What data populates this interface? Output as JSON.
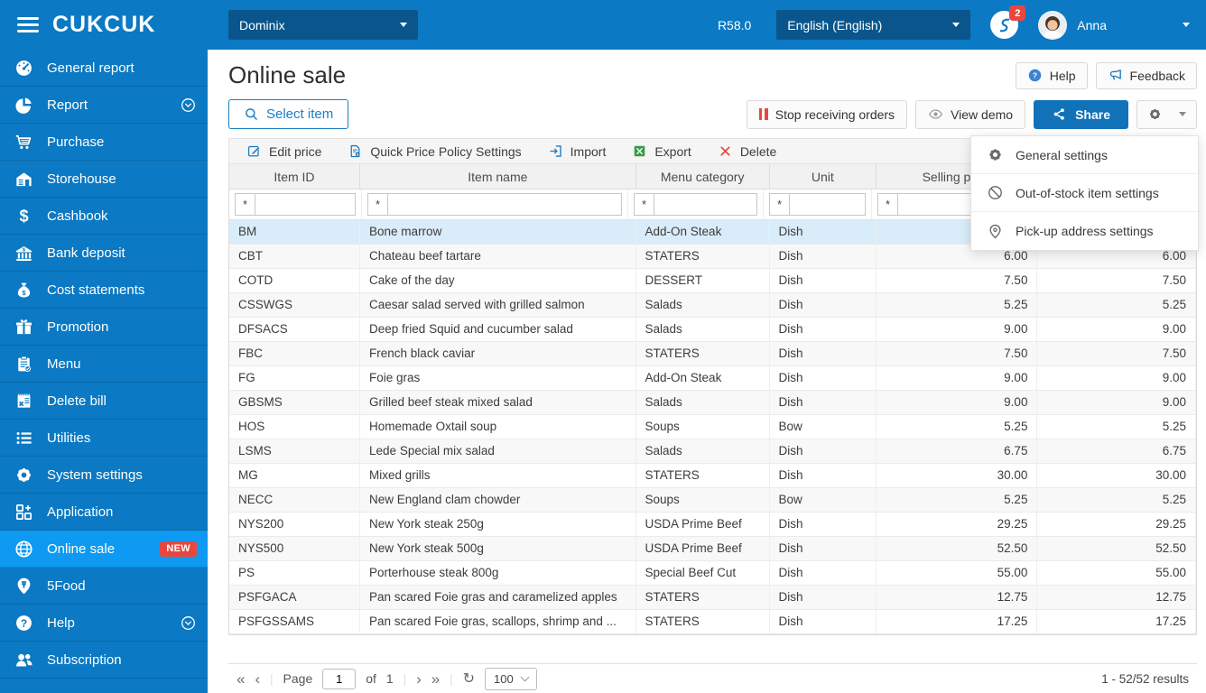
{
  "topbar": {
    "logo": "CUKCUK",
    "restaurant": "Dominix",
    "version": "R58.0",
    "language": "English (English)",
    "notification_count": "2",
    "user_name": "Anna"
  },
  "sidebar": {
    "items": [
      {
        "label": "General report",
        "icon": "gauge"
      },
      {
        "label": "Report",
        "icon": "pie",
        "expandable": true
      },
      {
        "label": "Purchase",
        "icon": "cart"
      },
      {
        "label": "Storehouse",
        "icon": "storehouse"
      },
      {
        "label": "Cashbook",
        "icon": "dollar"
      },
      {
        "label": "Bank deposit",
        "icon": "bank"
      },
      {
        "label": "Cost statements",
        "icon": "moneybag"
      },
      {
        "label": "Promotion",
        "icon": "gift"
      },
      {
        "label": "Menu",
        "icon": "clipboard"
      },
      {
        "label": "Delete bill",
        "icon": "bill-x"
      },
      {
        "label": "Utilities",
        "icon": "list"
      },
      {
        "label": "System settings",
        "icon": "gear-white"
      },
      {
        "label": "Application",
        "icon": "apps"
      },
      {
        "label": "Online sale",
        "icon": "globe",
        "active": true,
        "badge": "NEW"
      },
      {
        "label": "5Food",
        "icon": "pin-fork"
      },
      {
        "label": "Help",
        "icon": "question",
        "expandable": true
      },
      {
        "label": "Subscription",
        "icon": "users"
      }
    ]
  },
  "page": {
    "title": "Online sale",
    "help": "Help",
    "feedback": "Feedback",
    "select_item": "Select item",
    "stop_receiving_orders": "Stop receiving orders",
    "view_demo": "View demo",
    "share": "Share"
  },
  "toolbar": {
    "items": [
      {
        "label": "Edit price",
        "icon": "edit"
      },
      {
        "label": "Quick Price Policy Settings",
        "icon": "doc-badge"
      },
      {
        "label": "Import",
        "icon": "import"
      },
      {
        "label": "Export",
        "icon": "excel"
      },
      {
        "label": "Delete",
        "icon": "x-red"
      }
    ]
  },
  "settings_menu": {
    "items": [
      {
        "label": "General settings",
        "icon": "gear-gray"
      },
      {
        "label": "Out-of-stock item settings",
        "icon": "slash-circle"
      },
      {
        "label": "Pick-up address settings",
        "icon": "pin-outline"
      }
    ]
  },
  "table": {
    "columns": [
      "Item ID",
      "Item name",
      "Menu category",
      "Unit",
      "Selling price",
      ""
    ],
    "filter_operator": "*",
    "rows": [
      {
        "id": "BM",
        "name": "Bone marrow",
        "category": "Add-On Steak",
        "unit": "Dish",
        "price": "",
        "price2": "",
        "selected": true
      },
      {
        "id": "CBT",
        "name": "Chateau beef tartare",
        "category": "STATERS",
        "unit": "Dish",
        "price": "6.00",
        "price2": "6.00"
      },
      {
        "id": "COTD",
        "name": "Cake of the day",
        "category": "DESSERT",
        "unit": "Dish",
        "price": "7.50",
        "price2": "7.50"
      },
      {
        "id": "CSSWGS",
        "name": "Caesar salad served with grilled salmon",
        "category": "Salads",
        "unit": "Dish",
        "price": "5.25",
        "price2": "5.25"
      },
      {
        "id": "DFSACS",
        "name": "Deep fried Squid and cucumber salad",
        "category": "Salads",
        "unit": "Dish",
        "price": "9.00",
        "price2": "9.00"
      },
      {
        "id": "FBC",
        "name": "French black caviar",
        "category": "STATERS",
        "unit": "Dish",
        "price": "7.50",
        "price2": "7.50"
      },
      {
        "id": "FG",
        "name": "Foie gras",
        "category": "Add-On Steak",
        "unit": "Dish",
        "price": "9.00",
        "price2": "9.00"
      },
      {
        "id": "GBSMS",
        "name": "Grilled beef steak mixed salad",
        "category": "Salads",
        "unit": "Dish",
        "price": "9.00",
        "price2": "9.00"
      },
      {
        "id": "HOS",
        "name": "Homemade Oxtail soup",
        "category": "Soups",
        "unit": "Bow",
        "price": "5.25",
        "price2": "5.25"
      },
      {
        "id": "LSMS",
        "name": "Lede Special mix salad",
        "category": "Salads",
        "unit": "Dish",
        "price": "6.75",
        "price2": "6.75"
      },
      {
        "id": "MG",
        "name": "Mixed grills",
        "category": "STATERS",
        "unit": "Dish",
        "price": "30.00",
        "price2": "30.00"
      },
      {
        "id": "NECC",
        "name": "New England clam chowder",
        "category": "Soups",
        "unit": "Bow",
        "price": "5.25",
        "price2": "5.25"
      },
      {
        "id": "NYS200",
        "name": "New York steak 250g",
        "category": "USDA Prime Beef",
        "unit": "Dish",
        "price": "29.25",
        "price2": "29.25"
      },
      {
        "id": "NYS500",
        "name": "New York steak 500g",
        "category": "USDA Prime Beef",
        "unit": "Dish",
        "price": "52.50",
        "price2": "52.50"
      },
      {
        "id": "PS",
        "name": "Porterhouse steak 800g",
        "category": "Special Beef Cut",
        "unit": "Dish",
        "price": "55.00",
        "price2": "55.00"
      },
      {
        "id": "PSFGACA",
        "name": "Pan scared Foie gras and caramelized apples",
        "category": "STATERS",
        "unit": "Dish",
        "price": "12.75",
        "price2": "12.75"
      },
      {
        "id": "PSFGSSAMS",
        "name": "Pan scared Foie gras, scallops, shrimp and ...",
        "category": "STATERS",
        "unit": "Dish",
        "price": "17.25",
        "price2": "17.25"
      }
    ]
  },
  "pagination": {
    "page_label": "Page",
    "page_value": "1",
    "of_label": "of",
    "total_pages": "1",
    "page_size": "100",
    "results": "1 - 52/52 results"
  }
}
